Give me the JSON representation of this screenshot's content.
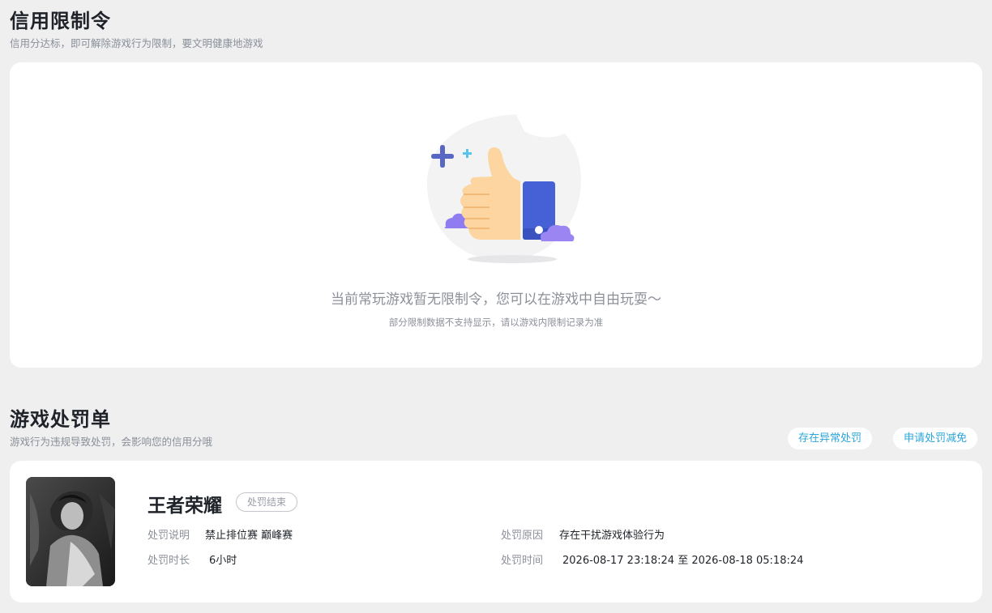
{
  "credit": {
    "title": "信用限制令",
    "subtitle": "信用分达标，即可解除游戏行为限制，要文明健康地游戏",
    "empty_main": "当前常玩游戏暂无限制令，您可以在游戏中自由玩耍～",
    "empty_sub": "部分限制数据不支持显示，请以游戏内限制记录为准",
    "illustration_icon": "thumbs-up-icon"
  },
  "penalty": {
    "title": "游戏处罚单",
    "subtitle": "游戏行为违规导致处罚，会影响您的信用分哦",
    "btn_abnormal": "存在异常处罚",
    "btn_apply": "申请处罚减免",
    "item": {
      "game": "王者荣耀",
      "status": "处罚结束",
      "desc_label": "处罚说明",
      "desc_value": "禁止排位赛 巅峰赛",
      "duration_label": "处罚时长",
      "duration_value": "6小时",
      "reason_label": "处罚原因",
      "reason_value": "存在干扰游戏体验行为",
      "time_label": "处罚时间",
      "time_value": "2026-08-17 23:18:24 至 2026-08-18 05:18:24"
    }
  },
  "colors": {
    "accent": "#2aa6d9",
    "page_bg": "#efefef",
    "card_bg": "#ffffff"
  }
}
